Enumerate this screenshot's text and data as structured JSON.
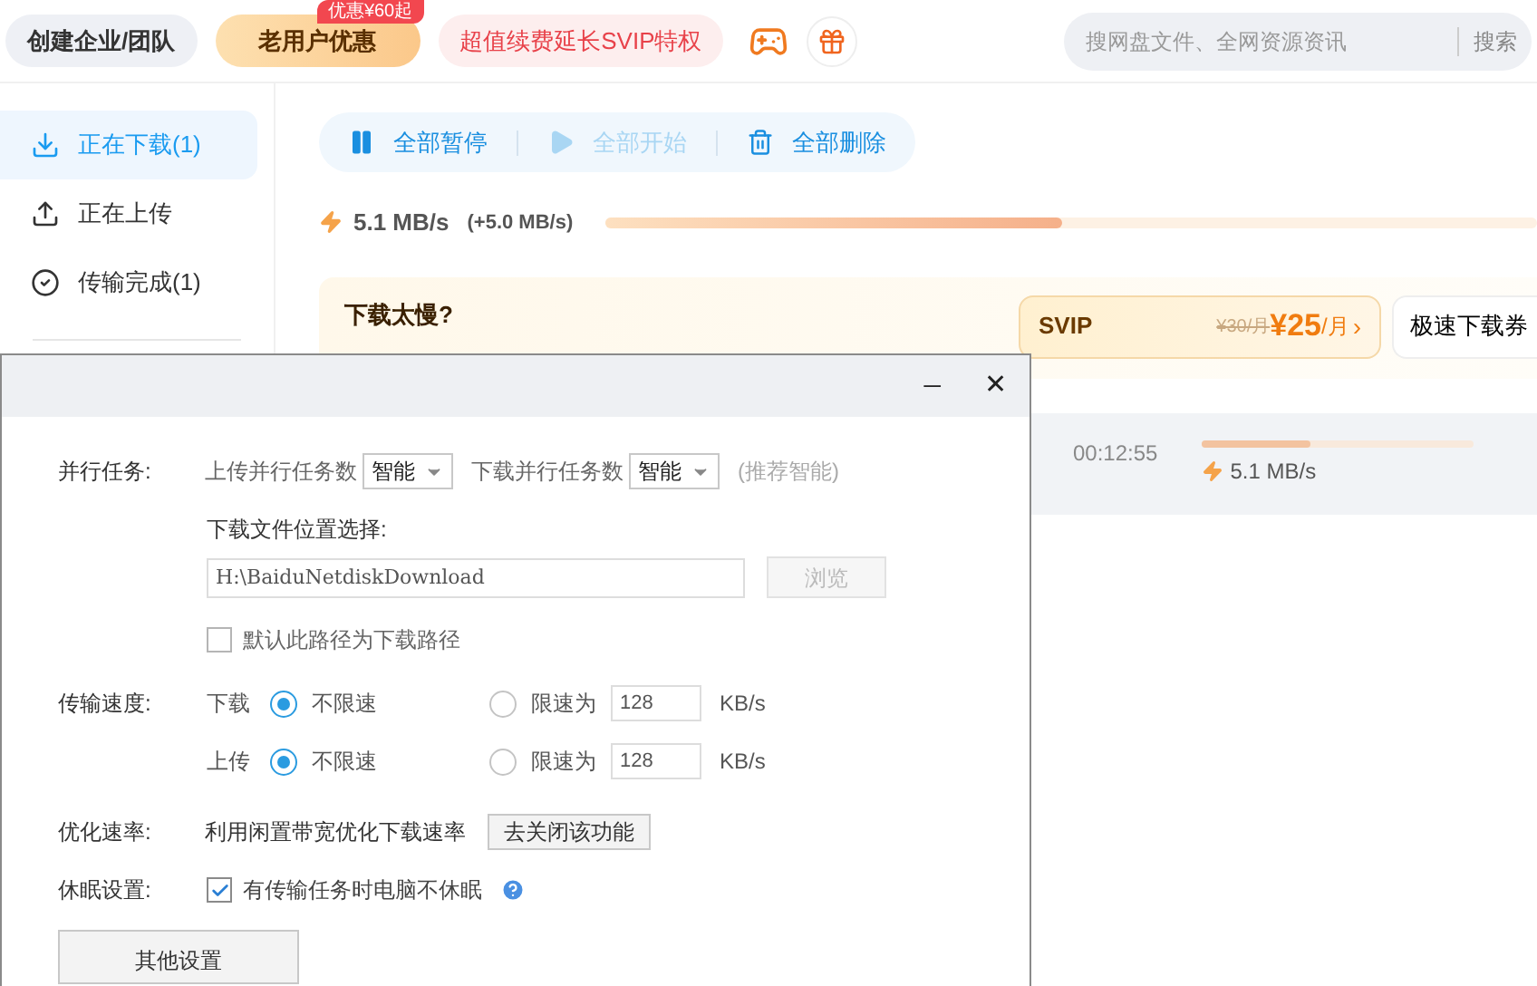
{
  "topbar": {
    "buttons": [
      {
        "label": "创建企业/团队",
        "kind": "plain"
      },
      {
        "label": "老用户优惠",
        "kind": "promo",
        "badge": "优惠¥60起"
      },
      {
        "label": "超值续费延长SVIP特权",
        "kind": "pink"
      }
    ],
    "search": {
      "placeholder": "搜网盘文件、全网资源资讯",
      "button": "搜索"
    }
  },
  "sidebar": {
    "items": [
      {
        "label": "正在下载(1)",
        "selected": true
      },
      {
        "label": "正在上传",
        "selected": false
      },
      {
        "label": "传输完成(1)",
        "selected": false
      }
    ]
  },
  "toolbar": {
    "buttons": [
      {
        "label": "全部暂停",
        "disabled": false
      },
      {
        "label": "全部开始",
        "disabled": true
      },
      {
        "label": "全部删除",
        "disabled": false
      }
    ]
  },
  "speed": {
    "value": "5.1 MB/s",
    "boost": "(+5.0 MB/s)",
    "level": 0.49
  },
  "promo": {
    "title": "下载太慢?",
    "svip": {
      "label": "SVIP",
      "old_price": "¥30/月",
      "price": "¥25",
      "unit": "/月",
      "arrow": "›"
    },
    "voucher": "极速下载券"
  },
  "task": {
    "time": "00:12:55",
    "level": 0.4,
    "speed": "5.1 MB/s"
  },
  "dialog": {
    "controls": [
      "─",
      "✕"
    ],
    "parallel": {
      "label": "并行任务:",
      "upload_label": "上传并行任务数",
      "upload_value": "智能",
      "download_label": "下载并行任务数",
      "download_value": "智能",
      "hint": "(推荐智能)"
    },
    "location": {
      "label": "下载文件位置选择:",
      "path": "H:\\BaiduNetdiskDownload",
      "browse": "浏览",
      "default_checkbox": {
        "label": "默认此路径为下载路径",
        "checked": false
      }
    },
    "transfer": {
      "label": "传输速度:",
      "rows": [
        {
          "direction": "下载",
          "options": [
            {
              "kind": "plain",
              "label": "不限速",
              "selected": true
            },
            {
              "kind": "limit",
              "label": "限速为",
              "value": "128",
              "unit": "KB/s",
              "selected": false
            }
          ]
        },
        {
          "direction": "上传",
          "options": [
            {
              "kind": "plain",
              "label": "不限速",
              "selected": true
            },
            {
              "kind": "limit",
              "label": "限速为",
              "value": "128",
              "unit": "KB/s",
              "selected": false
            }
          ]
        }
      ]
    },
    "optimize": {
      "label": "优化速率:",
      "text": "利用闲置带宽优化下载速率",
      "button": "去关闭该功能"
    },
    "sleep": {
      "label": "休眠设置:",
      "checkbox": {
        "label": "有传输任务时电脑不休眠",
        "checked": true
      }
    },
    "other_button": "其他设置"
  }
}
